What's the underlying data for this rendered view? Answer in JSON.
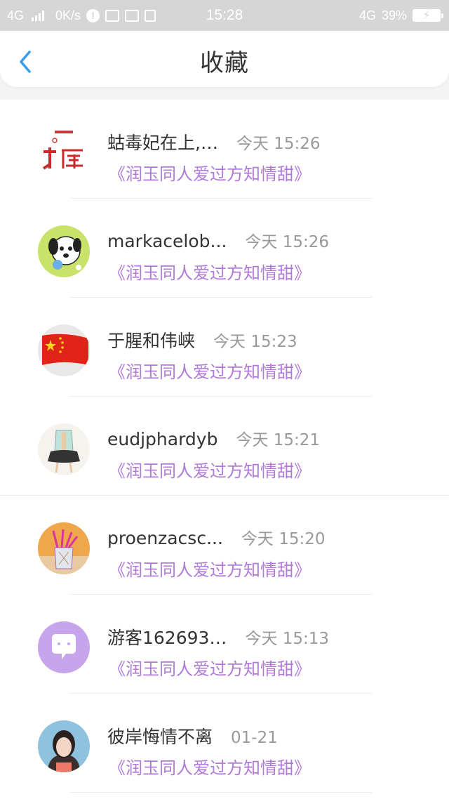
{
  "status_bar": {
    "network_left": "4G",
    "speed": "0K/s",
    "time": "15:28",
    "network_right": "4G",
    "battery": "39%"
  },
  "header": {
    "title": "收藏",
    "back_icon": "chevron-left-icon"
  },
  "colors": {
    "accent": "#3a9be8",
    "subtitle": "#b07ad8",
    "status_bar_bg": "#d6d6d6"
  },
  "items": [
    {
      "name": "蛄毒妃在上,…",
      "time": "今天 15:26",
      "subtitle": "《润玉同人爱过方知情甜》",
      "avatar": "red-calligraphy-avatar"
    },
    {
      "name": "markacelob...",
      "time": "今天 15:26",
      "subtitle": "《润玉同人爱过方知情甜》",
      "avatar": "cartoon-dog-avatar"
    },
    {
      "name": "于腥和伟峡",
      "time": "今天 15:23",
      "subtitle": "《润玉同人爱过方知情甜》",
      "avatar": "china-flag-avatar"
    },
    {
      "name": "eudjphardyb",
      "time": "今天 15:21",
      "subtitle": "《润玉同人爱过方知情甜》",
      "avatar": "anime-girl-avatar"
    },
    {
      "name": "proenzacsc...",
      "time": "今天 15:20",
      "subtitle": "《润玉同人爱过方知情甜》",
      "avatar": "pencil-cup-avatar"
    },
    {
      "name": "游客162693…",
      "time": "今天 15:13",
      "subtitle": "《润玉同人爱过方知情甜》",
      "avatar": "chat-bubble-avatar"
    },
    {
      "name": "彼岸悔情不离",
      "time": "01-21",
      "subtitle": "《润玉同人爱过方知情甜》",
      "avatar": "girl-photo-avatar"
    }
  ]
}
